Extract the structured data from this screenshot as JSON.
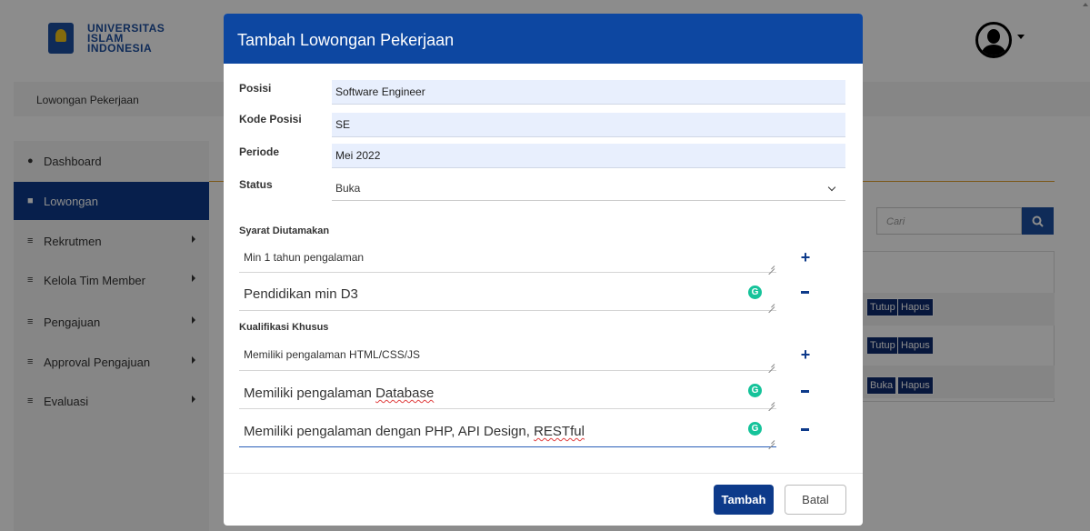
{
  "header": {
    "logo_lines": [
      "UNIVERSITAS",
      "ISLAM",
      "INDONESIA"
    ]
  },
  "breadcrumb": "Lowongan Pekerjaan",
  "sidebar": {
    "items": [
      {
        "label": "Dashboard",
        "icon": "dashboard-icon",
        "active": false,
        "has_arrow": false
      },
      {
        "label": "Lowongan",
        "icon": "briefcase-icon",
        "active": true,
        "has_arrow": false
      },
      {
        "label": "Rekrutmen",
        "icon": "list-icon",
        "active": false,
        "has_arrow": true
      },
      {
        "label": "Kelola Tim Member",
        "icon": "list-icon",
        "active": false,
        "has_arrow": true
      },
      {
        "label": "Pengajuan",
        "icon": "list-icon",
        "active": false,
        "has_arrow": true
      },
      {
        "label": "Approval Pengajuan",
        "icon": "list-icon",
        "active": false,
        "has_arrow": true
      },
      {
        "label": "Evaluasi",
        "icon": "list-icon",
        "active": false,
        "has_arrow": true
      }
    ]
  },
  "content": {
    "search_placeholder": "Cari",
    "rows": [
      {
        "toggle": "Tutup",
        "delete": "Hapus"
      },
      {
        "toggle": "Tutup",
        "delete": "Hapus"
      },
      {
        "toggle": "Buka",
        "delete": "Hapus"
      }
    ]
  },
  "modal": {
    "title": "Tambah Lowongan Pekerjaan",
    "fields": {
      "posisi": {
        "label": "Posisi",
        "value": "Software Engineer"
      },
      "kode_posisi": {
        "label": "Kode Posisi",
        "value": "SE"
      },
      "periode": {
        "label": "Periode",
        "value": "Mei 2022"
      },
      "status": {
        "label": "Status",
        "value": "Buka"
      }
    },
    "syarat": {
      "title": "Syarat Diutamakan",
      "items": [
        "Min 1 tahun pengalaman",
        "Pendidikan min D3"
      ]
    },
    "kualifikasi": {
      "title": "Kualifikasi Khusus",
      "items": [
        "Memiliki pengalaman HTML/CSS/JS",
        "Memiliki pengalaman Database",
        "Memiliki pengalaman dengan PHP, API Design, RESTful"
      ]
    },
    "submit_label": "Tambah",
    "cancel_label": "Batal"
  },
  "colors": {
    "primary": "#0d47a1",
    "button": "#0d3a8a",
    "grammarly": "#15c39a"
  }
}
